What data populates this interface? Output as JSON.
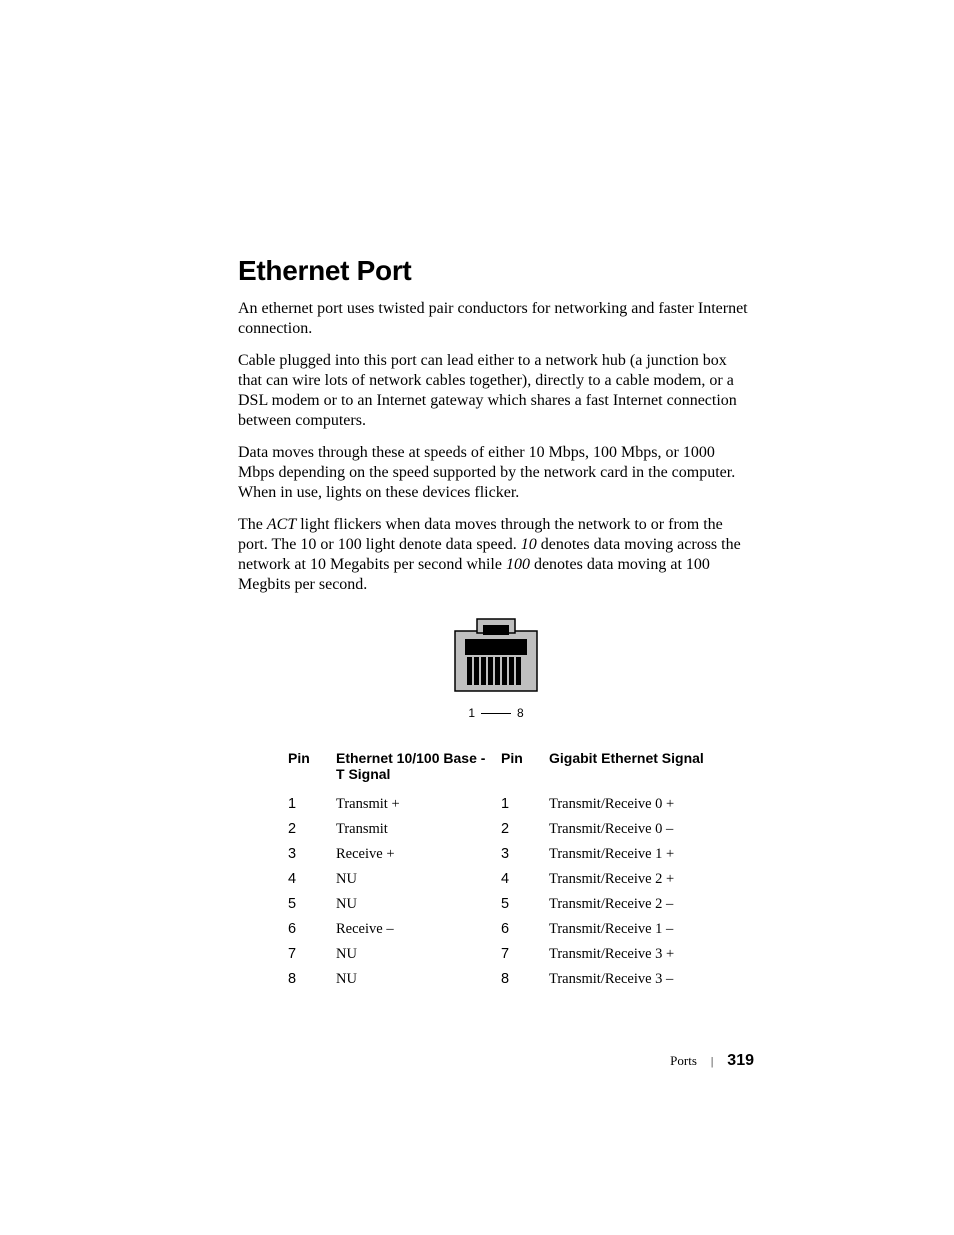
{
  "heading": "Ethernet Port",
  "para1": "An ethernet port uses twisted pair conductors for networking and faster Internet connection.",
  "para2": "Cable plugged into this port can lead either to a network hub (a junction box that can wire lots of network cables together), directly to a cable modem, or a DSL modem or to an Internet gateway which shares a fast Internet connection between computers.",
  "para3": "Data moves through these at speeds of either 10 Mbps, 100 Mbps, or 1000 Mbps depending on the speed supported by the network card in the computer. When in use, lights on these devices flicker.",
  "para4_a": "The ",
  "para4_b": "ACT",
  "para4_c": " light flickers when data moves through the network to or from the port. The 10 or 100 light denote data speed. ",
  "para4_d": "10",
  "para4_e": " denotes data moving across the network at 10 Megabits per second while ",
  "para4_f": "100",
  "para4_g": " denotes data moving at 100 Megbits per second.",
  "pin_left": "1",
  "pin_right": "8",
  "headers": {
    "pin": "Pin",
    "eth": "Ethernet 10/100 Base - T Signal",
    "pin2": "Pin",
    "gig": "Gigabit Ethernet Signal"
  },
  "rows": [
    {
      "p": "1",
      "e": "Transmit +",
      "p2": "1",
      "g": "Transmit/Receive 0 +"
    },
    {
      "p": "2",
      "e": "Transmit",
      "p2": "2",
      "g": "Transmit/Receive 0 –"
    },
    {
      "p": "3",
      "e": "Receive +",
      "p2": "3",
      "g": "Transmit/Receive 1 +"
    },
    {
      "p": "4",
      "e": "NU",
      "p2": "4",
      "g": "Transmit/Receive 2 +"
    },
    {
      "p": "5",
      "e": "NU",
      "p2": "5",
      "g": "Transmit/Receive 2 –"
    },
    {
      "p": "6",
      "e": "Receive –",
      "p2": "6",
      "g": "Transmit/Receive 1 –"
    },
    {
      "p": "7",
      "e": "NU",
      "p2": "7",
      "g": "Transmit/Receive 3 +"
    },
    {
      "p": "8",
      "e": "NU",
      "p2": "8",
      "g": "Transmit/Receive 3 –"
    }
  ],
  "footer_section": "Ports",
  "footer_page": "319"
}
